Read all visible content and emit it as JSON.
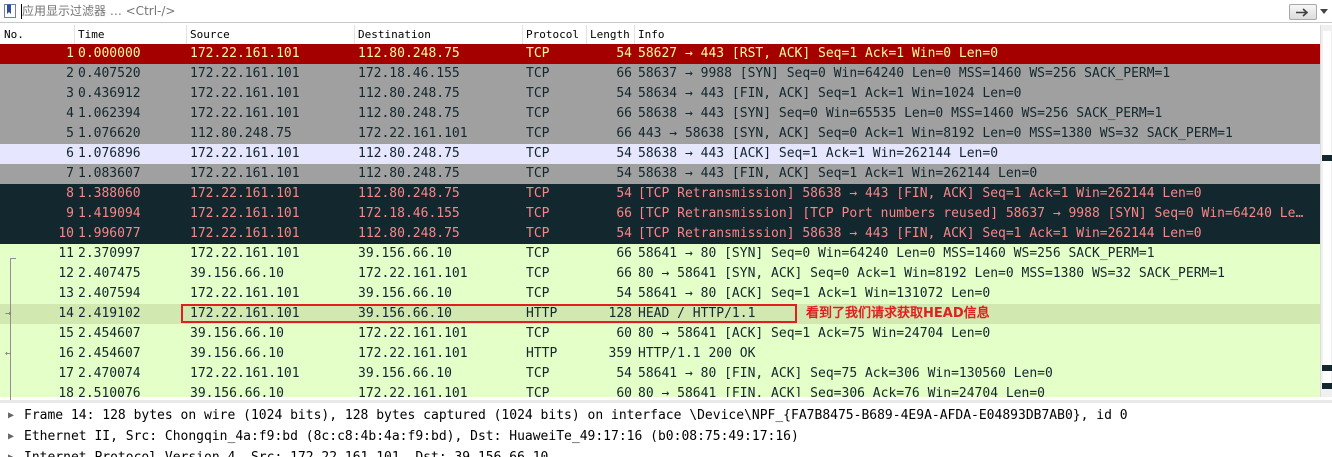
{
  "filter": {
    "placeholder": "应用显示过滤器 … <Ctrl-/>",
    "icons": [
      "bookmark-icon",
      "apply-arrow-icon",
      "dropdown-icon"
    ]
  },
  "columns": [
    "No.",
    "Time",
    "Source",
    "Destination",
    "Protocol",
    "Length",
    "Info"
  ],
  "packets": [
    {
      "no": "1",
      "time": "0.000000",
      "src": "172.22.161.101",
      "dst": "112.80.248.75",
      "proto": "TCP",
      "len": "54",
      "info": "58627 → 443 [RST, ACK] Seq=1 Ack=1 Win=0 Len=0",
      "style": "rst"
    },
    {
      "no": "2",
      "time": "0.407520",
      "src": "172.22.161.101",
      "dst": "172.18.46.155",
      "proto": "TCP",
      "len": "66",
      "info": "58637 → 9988 [SYN] Seq=0 Win=64240 Len=0 MSS=1460 WS=256 SACK_PERM=1",
      "style": "gray"
    },
    {
      "no": "3",
      "time": "0.436912",
      "src": "172.22.161.101",
      "dst": "112.80.248.75",
      "proto": "TCP",
      "len": "54",
      "info": "58634 → 443 [FIN, ACK] Seq=1 Ack=1 Win=1024 Len=0",
      "style": "gray"
    },
    {
      "no": "4",
      "time": "1.062394",
      "src": "172.22.161.101",
      "dst": "112.80.248.75",
      "proto": "TCP",
      "len": "66",
      "info": "58638 → 443 [SYN] Seq=0 Win=65535 Len=0 MSS=1460 WS=256 SACK_PERM=1",
      "style": "gray"
    },
    {
      "no": "5",
      "time": "1.076620",
      "src": "112.80.248.75",
      "dst": "172.22.161.101",
      "proto": "TCP",
      "len": "66",
      "info": "443 → 58638 [SYN, ACK] Seq=0 Ack=1 Win=8192 Len=0 MSS=1380 WS=32 SACK_PERM=1",
      "style": "gray"
    },
    {
      "no": "6",
      "time": "1.076896",
      "src": "172.22.161.101",
      "dst": "112.80.248.75",
      "proto": "TCP",
      "len": "54",
      "info": "58638 → 443 [ACK] Seq=1 Ack=1 Win=262144 Len=0",
      "style": "sel"
    },
    {
      "no": "7",
      "time": "1.083607",
      "src": "172.22.161.101",
      "dst": "112.80.248.75",
      "proto": "TCP",
      "len": "54",
      "info": "58638 → 443 [FIN, ACK] Seq=1 Ack=1 Win=262144 Len=0",
      "style": "gray"
    },
    {
      "no": "8",
      "time": "1.388060",
      "src": "172.22.161.101",
      "dst": "112.80.248.75",
      "proto": "TCP",
      "len": "54",
      "info": "[TCP Retransmission] 58638 → 443 [FIN, ACK] Seq=1 Ack=1 Win=262144 Len=0",
      "style": "dark"
    },
    {
      "no": "9",
      "time": "1.419094",
      "src": "172.22.161.101",
      "dst": "172.18.46.155",
      "proto": "TCP",
      "len": "66",
      "info": "[TCP Retransmission] [TCP Port numbers reused] 58637 → 9988 [SYN] Seq=0 Win=64240 Le…",
      "style": "dark"
    },
    {
      "no": "10",
      "time": "1.996077",
      "src": "172.22.161.101",
      "dst": "112.80.248.75",
      "proto": "TCP",
      "len": "54",
      "info": "[TCP Retransmission] 58638 → 443 [FIN, ACK] Seq=1 Ack=1 Win=262144 Len=0",
      "style": "dark"
    },
    {
      "no": "11",
      "time": "2.370997",
      "src": "172.22.161.101",
      "dst": "39.156.66.10",
      "proto": "TCP",
      "len": "66",
      "info": "58641 → 80 [SYN] Seq=0 Win=64240 Len=0 MSS=1460 WS=256 SACK_PERM=1",
      "style": "green"
    },
    {
      "no": "12",
      "time": "2.407475",
      "src": "39.156.66.10",
      "dst": "172.22.161.101",
      "proto": "TCP",
      "len": "66",
      "info": "80 → 58641 [SYN, ACK] Seq=0 Ack=1 Win=8192 Len=0 MSS=1380 WS=32 SACK_PERM=1",
      "style": "green"
    },
    {
      "no": "13",
      "time": "2.407594",
      "src": "172.22.161.101",
      "dst": "39.156.66.10",
      "proto": "TCP",
      "len": "54",
      "info": "58641 → 80 [ACK] Seq=1 Ack=1 Win=131072 Len=0",
      "style": "green"
    },
    {
      "no": "14",
      "time": "2.419102",
      "src": "172.22.161.101",
      "dst": "39.156.66.10",
      "proto": "HTTP",
      "len": "128",
      "info": "HEAD / HTTP/1.1",
      "style": "related"
    },
    {
      "no": "15",
      "time": "2.454607",
      "src": "39.156.66.10",
      "dst": "172.22.161.101",
      "proto": "TCP",
      "len": "60",
      "info": "80 → 58641 [ACK] Seq=1 Ack=75 Win=24704 Len=0",
      "style": "green"
    },
    {
      "no": "16",
      "time": "2.454607",
      "src": "39.156.66.10",
      "dst": "172.22.161.101",
      "proto": "HTTP",
      "len": "359",
      "info": "HTTP/1.1 200 OK",
      "style": "green"
    },
    {
      "no": "17",
      "time": "2.470074",
      "src": "172.22.161.101",
      "dst": "39.156.66.10",
      "proto": "TCP",
      "len": "54",
      "info": "58641 → 80 [FIN, ACK] Seq=75 Ack=306 Win=130560 Len=0",
      "style": "green"
    },
    {
      "no": "18",
      "time": "2.510076",
      "src": "39.156.66.10",
      "dst": "172.22.161.101",
      "proto": "TCP",
      "len": "60",
      "info": "80 → 58641 [FIN, ACK] Seq=306 Ack=76 Win=24704 Len=0",
      "style": "green"
    }
  ],
  "annotation": "看到了我们请求获取HEAD信息",
  "details": [
    "Frame 14: 128 bytes on wire (1024 bits), 128 bytes captured (1024 bits) on interface \\Device\\NPF_{FA7B8475-B689-4E9A-AFDA-E04893DB7AB0}, id 0",
    "Ethernet II, Src: Chongqin_4a:f9:bd (8c:c8:4b:4a:f9:bd), Dst: HuaweiTe_49:17:16 (b0:08:75:49:17:16)",
    "Internet Protocol Version 4, Src: 172.22.161.101, Dst: 39.156.66.10"
  ],
  "colors": {
    "rst_bg": "#a40000",
    "rst_fg": "#fffc9c",
    "gray_bg": "#a0a0a0",
    "dark_bg": "#12272e",
    "dark_fg": "#f78787",
    "green_bg": "#e4ffc7",
    "selected_bg": "#e7e6ff",
    "annotation": "#e02020"
  }
}
